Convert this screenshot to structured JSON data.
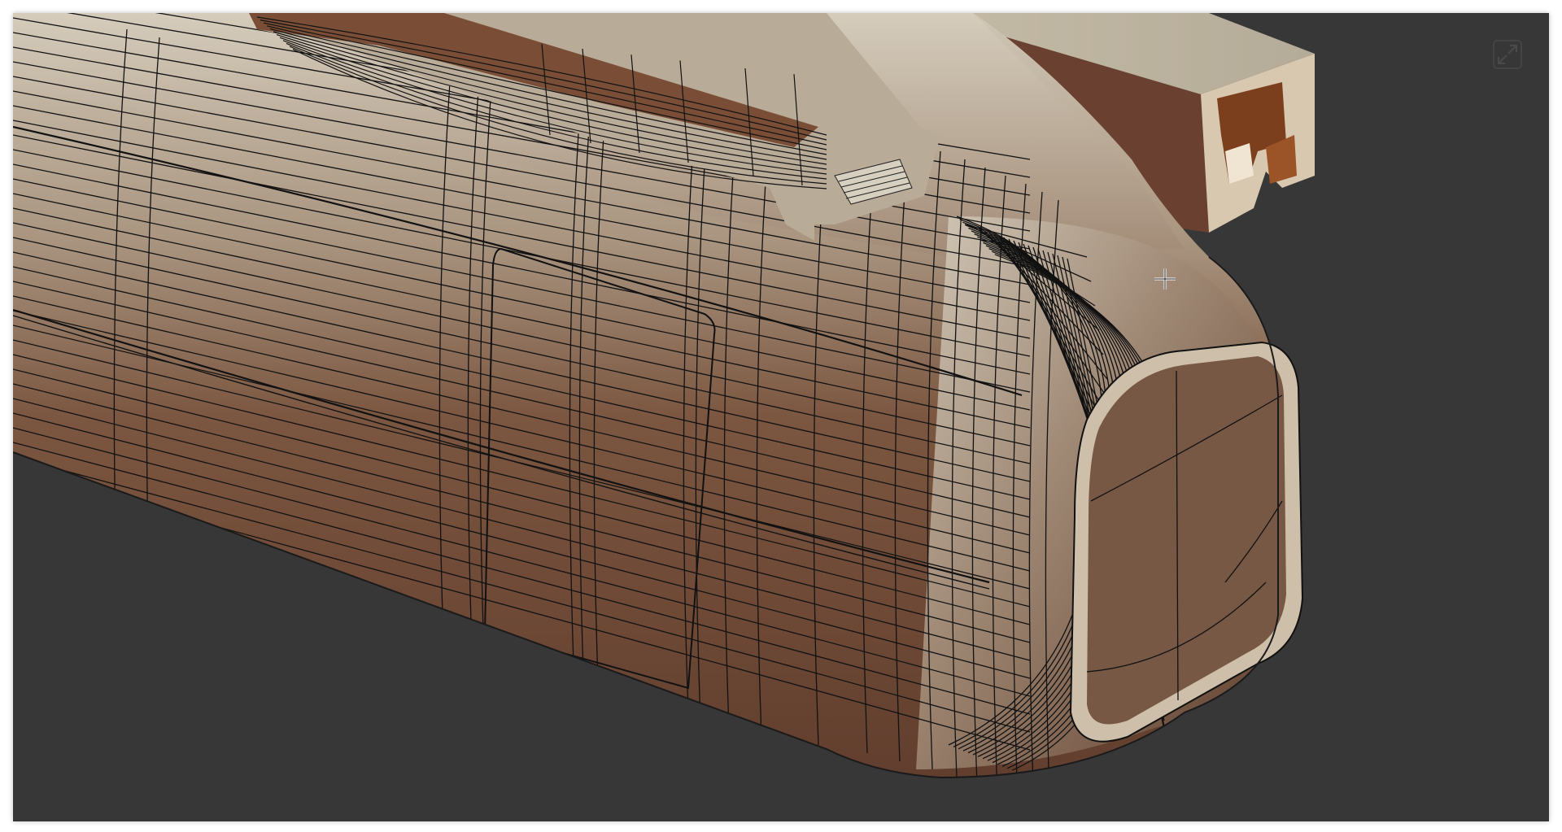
{
  "app": {
    "view": "3d-viewport",
    "shading": "wireframe-on-shaded"
  },
  "viewport": {
    "background_color": "#373737",
    "maximize_icon": "maximize-icon",
    "cursor_icon": "crosshair-cursor-icon"
  },
  "model": {
    "objects": [
      {
        "name_icon": "train-car-body-mesh"
      },
      {
        "name_icon": "roof-rail-beam-mesh"
      },
      {
        "name_icon": "pantograph-part-mesh"
      }
    ]
  },
  "colors": {
    "mesh_dark": "#6b4533",
    "mesh_mid": "#8a6a52",
    "mesh_light": "#c9bfae",
    "beam_face": "#6a4130",
    "beam_top": "#c3b9a4",
    "beam_end": "#d9c9b3",
    "wire": "#111111"
  }
}
